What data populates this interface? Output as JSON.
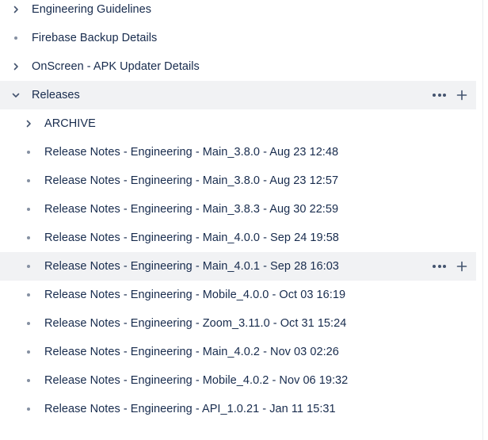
{
  "tree": {
    "items": [
      {
        "label": "Engineering Guidelines",
        "type": "chevron-right",
        "level": 0
      },
      {
        "label": "Firebase Backup Details",
        "type": "bullet",
        "level": 0
      },
      {
        "label": "OnScreen - APK Updater Details",
        "type": "chevron-right",
        "level": 0
      },
      {
        "label": "Releases",
        "type": "chevron-down",
        "level": 0,
        "expanded": true,
        "selected": true
      },
      {
        "label": "ARCHIVE",
        "type": "chevron-right",
        "level": 1
      },
      {
        "label": "Release Notes - Engineering - Main_3.8.0 - Aug 23 12:48",
        "type": "bullet",
        "level": 1
      },
      {
        "label": "Release Notes - Engineering - Main_3.8.0 - Aug 23 12:57",
        "type": "bullet",
        "level": 1
      },
      {
        "label": "Release Notes - Engineering - Main_3.8.3 - Aug 30 22:59",
        "type": "bullet",
        "level": 1
      },
      {
        "label": "Release Notes - Engineering - Main_4.0.0 - Sep 24 19:58",
        "type": "bullet",
        "level": 1
      },
      {
        "label": "Release Notes - Engineering - Main_4.0.1 - Sep 28 16:03",
        "type": "bullet",
        "level": 1,
        "hovered": true
      },
      {
        "label": "Release Notes - Engineering - Mobile_4.0.0 - Oct 03 16:19",
        "type": "bullet",
        "level": 1
      },
      {
        "label": "Release Notes - Engineering - Zoom_3.11.0 - Oct 31 15:24",
        "type": "bullet",
        "level": 1
      },
      {
        "label": "Release Notes - Engineering - Main_4.0.2 - Nov 03 02:26",
        "type": "bullet",
        "level": 1
      },
      {
        "label": "Release Notes - Engineering - Mobile_4.0.2 - Nov 06 19:32",
        "type": "bullet",
        "level": 1
      },
      {
        "label": "Release Notes - Engineering - API_1.0.21 - Jan 11 15:31",
        "type": "bullet",
        "level": 1
      }
    ],
    "row_actions": {
      "more_icon": "more-horizontal-icon",
      "add_icon": "plus-icon"
    }
  },
  "colors": {
    "text": "#172b4d",
    "icon": "#44546f",
    "bullet": "#8590a2",
    "row_highlight": "#f1f2f4",
    "background": "#ffffff"
  }
}
